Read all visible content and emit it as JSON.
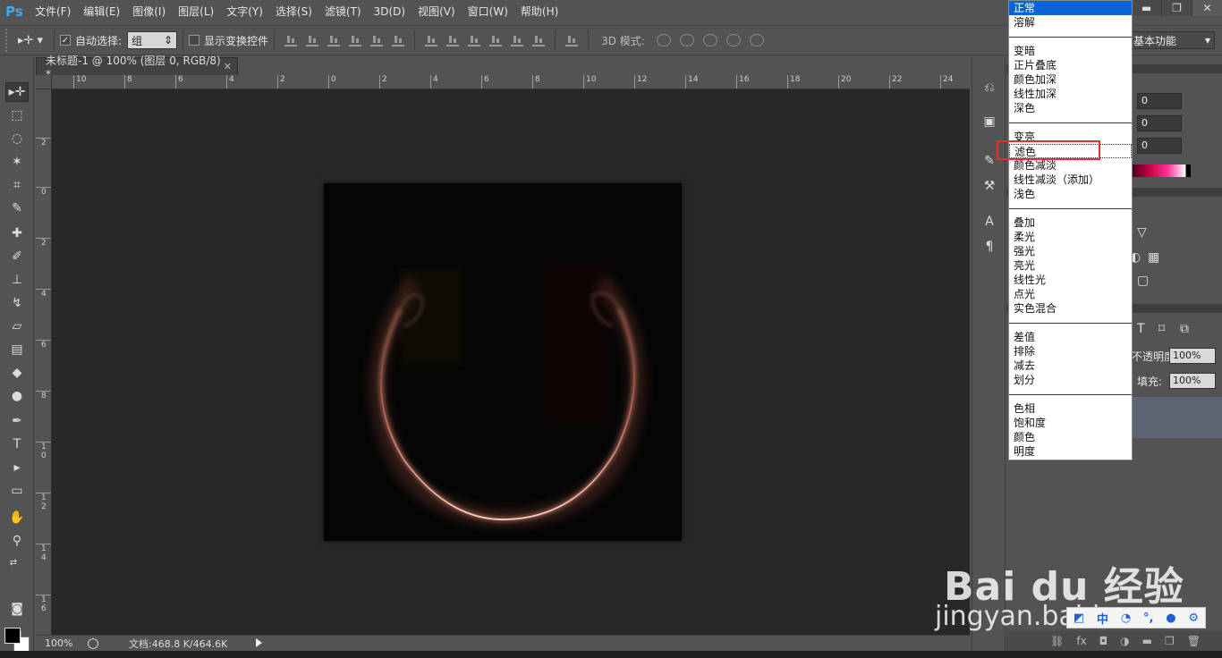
{
  "app": {
    "logo": "Ps"
  },
  "menu": [
    "文件(F)",
    "编辑(E)",
    "图像(I)",
    "图层(L)",
    "文字(Y)",
    "选择(S)",
    "滤镜(T)",
    "3D(D)",
    "视图(V)",
    "窗口(W)",
    "帮助(H)"
  ],
  "window_controls": {
    "minimize": "▬",
    "restore": "❐",
    "close": "✕"
  },
  "options": {
    "tool_icon": "move-tool-icon",
    "auto_select_label": "自动选择:",
    "auto_select_checked": true,
    "auto_select_value": "组",
    "show_transform_label": "显示变换控件",
    "show_transform_checked": false,
    "mode_3d_label": "3D 模式:",
    "workspace": "基本功能"
  },
  "document": {
    "tab_title": "未标题-1 @ 100% (图层 0, RGB/8) *",
    "ruler_top_labels": [
      "10",
      "8",
      "6",
      "4",
      "2",
      "0",
      "2",
      "4",
      "6",
      "8",
      "10",
      "12",
      "14",
      "16",
      "18",
      "20",
      "22",
      "24"
    ],
    "ruler_left_labels": [
      "2",
      "0",
      "2",
      "4",
      "6",
      "8",
      "1\n0",
      "1\n2",
      "1\n4",
      "1\n6"
    ]
  },
  "status": {
    "zoom": "100%",
    "doc_info": "文档:468.8 K/464.6K"
  },
  "panels": {
    "color_values": [
      "0",
      "0",
      "0"
    ],
    "opacity_label": "不透明度:",
    "opacity_value": "100%",
    "fill_label": "填充:",
    "fill_value": "100%"
  },
  "blend_modes": {
    "groups": [
      [
        "正常",
        "溶解"
      ],
      [
        "变暗",
        "正片叠底",
        "颜色加深",
        "线性加深",
        "深色"
      ],
      [
        "变亮",
        "滤色",
        "颜色减淡",
        "线性减淡（添加）",
        "浅色"
      ],
      [
        "叠加",
        "柔光",
        "强光",
        "亮光",
        "线性光",
        "点光",
        "实色混合"
      ],
      [
        "差值",
        "排除",
        "减去",
        "划分"
      ],
      [
        "色相",
        "饱和度",
        "颜色",
        "明度"
      ]
    ],
    "selected": "正常",
    "highlighted": "滤色"
  },
  "watermark": {
    "brand": "Bai du 经验",
    "url": "jingyan.baidu.com"
  },
  "ime": {
    "lang": "中"
  },
  "colors": {
    "accent": "#0a64d2",
    "highlight_box": "#e03030",
    "glow": "#f0a890"
  }
}
